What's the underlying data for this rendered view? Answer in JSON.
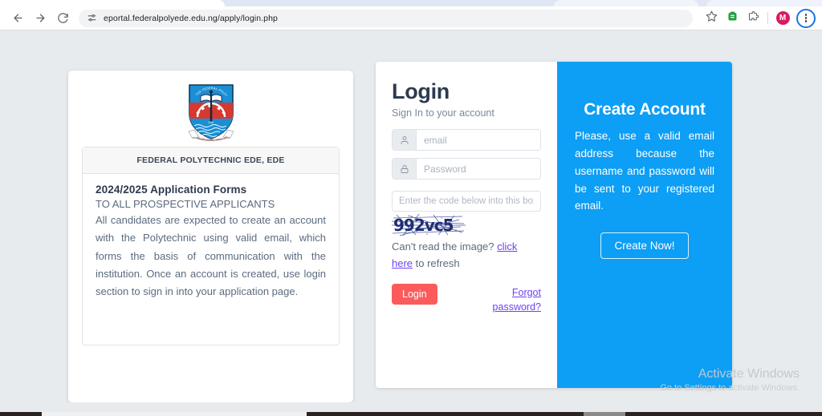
{
  "browser": {
    "back_icon": "arrow-left-icon",
    "forward_icon": "arrow-right-icon",
    "reload_icon": "reload-icon",
    "site_settings_icon": "tune-icon",
    "url": "eportal.federalpolyede.edu.ng/apply/login.php",
    "bookmark_icon": "star-icon",
    "extension_green_icon": "extension-green-icon",
    "extensions_icon": "puzzle-icon",
    "profile_initial": "M",
    "menu_icon": "kebab-menu-icon"
  },
  "left_card": {
    "logo_alt": "federal-polytechnic-ede-logo",
    "institution_name": "FEDERAL POLYTECHNIC EDE, EDE",
    "forms_title": "2024/2025 Application Forms",
    "prospective_line": "TO ALL PROSPECTIVE APPLICANTS",
    "body": "All candidates are expected to create an account with the Polytechnic using valid email, which forms the basis of communication with the institution. Once an account is created, use login section to sign in into your application page."
  },
  "login": {
    "title": "Login",
    "subtitle": "Sign In to your account",
    "email_placeholder": "email",
    "email_value": "",
    "email_icon": "user-icon",
    "password_placeholder": "Password",
    "password_value": "",
    "password_icon": "lock-icon",
    "captcha_placeholder": "Enter the code below into this box",
    "captcha_value": "",
    "captcha_code": "992vc5",
    "captcha_help_prefix": "Can't read the image? ",
    "captcha_help_link": "click here",
    "captcha_help_suffix": " to refresh",
    "login_button": "Login",
    "forgot_link": "Forgot password?"
  },
  "create": {
    "title": "Create Account",
    "text": "Please, use a valid email address because the username and password will be sent to your registered email.",
    "button": "Create Now!"
  },
  "watermark": {
    "title": "Activate Windows",
    "subtitle": "Go to Settings to activate Windows."
  },
  "colors": {
    "page_background": "#e8ebee",
    "create_panel": "#0d9ef5",
    "login_button": "#fc5b5b",
    "link": "#6f42f0",
    "captcha_text": "#1b2a6b"
  }
}
